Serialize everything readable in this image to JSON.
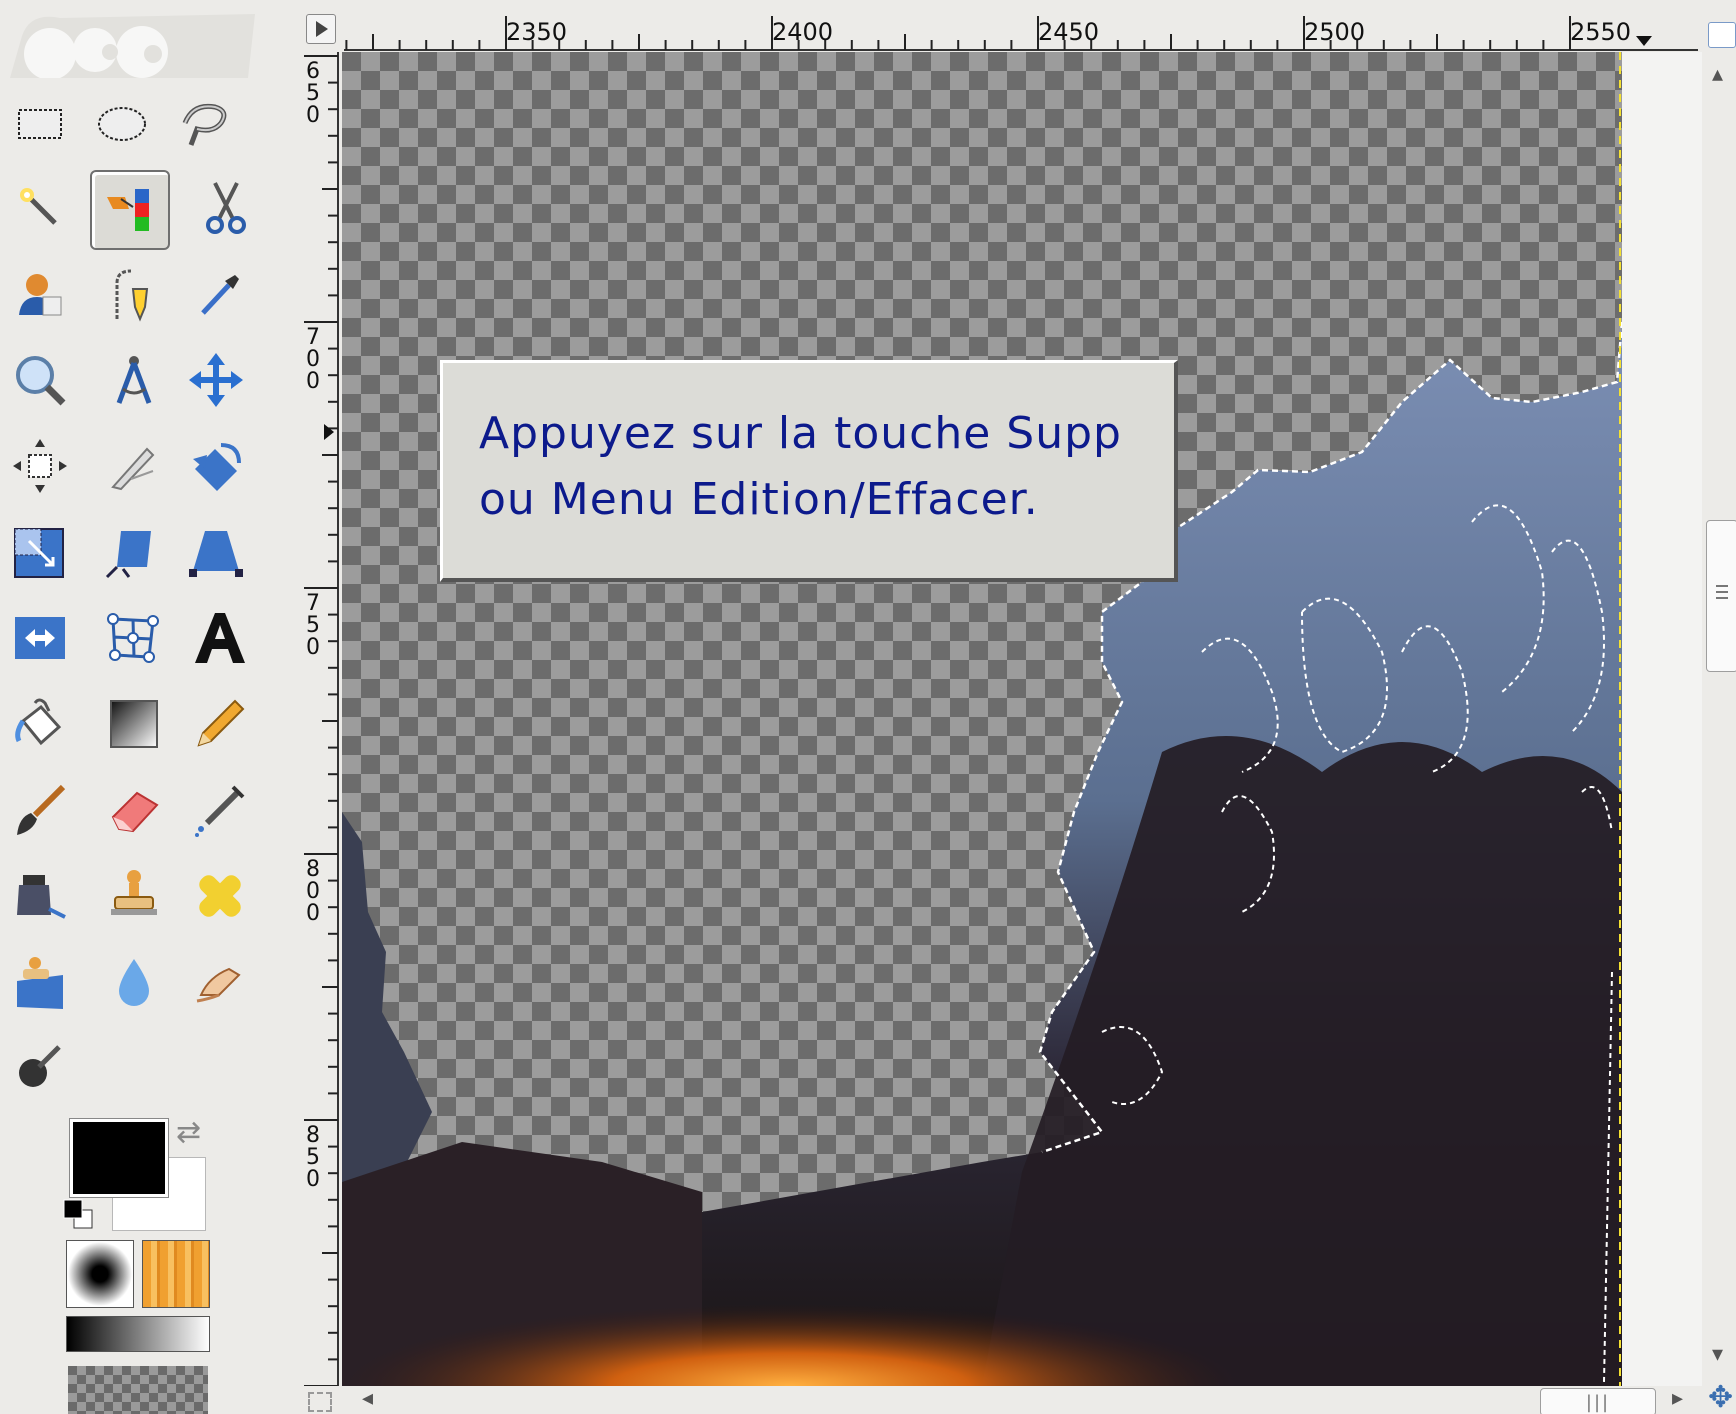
{
  "toolbox": {
    "active_tool": "fuzzy-select-by-color",
    "tools": [
      [
        "rect-select",
        "ellipse-select",
        "free-select"
      ],
      [
        "fuzzy-select",
        "select-by-color",
        "scissors-select"
      ],
      [
        "foreground-select",
        "paths",
        "color-picker"
      ],
      [
        "zoom",
        "measure",
        "move"
      ],
      [
        "align",
        "crop",
        "rotate"
      ],
      [
        "scale",
        "shear",
        "perspective"
      ],
      [
        "flip",
        "cage-transform",
        "text"
      ],
      [
        "bucket-fill",
        "blend",
        "pencil"
      ],
      [
        "paintbrush",
        "eraser",
        "airbrush"
      ],
      [
        "ink",
        "clone",
        "heal"
      ],
      [
        "perspective-clone",
        "blur-sharpen",
        "smudge"
      ],
      [
        "dodge-burn"
      ]
    ]
  },
  "rulers": {
    "horizontal_labels": [
      "2350",
      "2400",
      "2450",
      "2500",
      "2550"
    ],
    "vertical_labels": [
      "650",
      "700",
      "750",
      "800",
      "850"
    ]
  },
  "tooltip": {
    "line1": "Appuyez sur la touche Supp",
    "line2": "ou Menu Edition/Effacer."
  },
  "colors": {
    "foreground": "#000000",
    "background": "#ffffff",
    "tooltip_text": "#0c1a8c"
  }
}
